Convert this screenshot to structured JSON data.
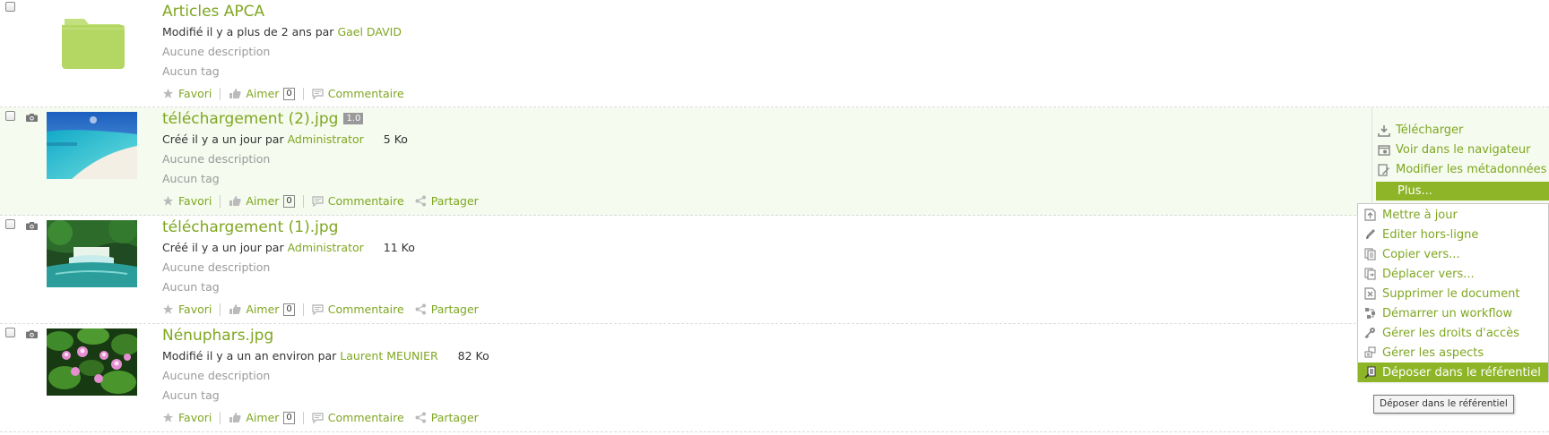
{
  "items": [
    {
      "title": "Articles APCA",
      "version": "",
      "meta_prefix": "Modifié il y a plus de 2 ans par",
      "author": "Gael DAVID",
      "size": "",
      "description": "Aucune description",
      "tags": "Aucun tag",
      "thumbnail": "folder-icon"
    },
    {
      "title": "téléchargement (2).jpg",
      "version": "1.0",
      "meta_prefix": "Créé il y a un jour par",
      "author": "Administrator",
      "size": "5 Ko",
      "description": "Aucune description",
      "tags": "Aucun tag",
      "thumbnail": "beach-image"
    },
    {
      "title": "téléchargement (1).jpg",
      "version": "",
      "meta_prefix": "Créé il y a un jour par",
      "author": "Administrator",
      "size": "11 Ko",
      "description": "Aucune description",
      "tags": "Aucun tag",
      "thumbnail": "waterfall-image"
    },
    {
      "title": "Nénuphars.jpg",
      "version": "",
      "meta_prefix": "Modifié il y a un an environ par",
      "author": "Laurent MEUNIER",
      "size": "82 Ko",
      "description": "Aucune description",
      "tags": "Aucun tag",
      "thumbnail": "water-lilies-image"
    }
  ],
  "actions": {
    "favori": "Favori",
    "aimer": "Aimer",
    "like_count": "0",
    "commentaire": "Commentaire",
    "partager": "Partager"
  },
  "right_menu": {
    "telecharger": "Télécharger",
    "voir": "Voir dans le navigateur",
    "modifier": "Modifier les métadonnées",
    "plus": "Plus..."
  },
  "dropdown": [
    {
      "label": "Mettre à jour",
      "icon": "upload-icon"
    },
    {
      "label": "Editer hors-ligne",
      "icon": "pencil-icon"
    },
    {
      "label": "Copier vers...",
      "icon": "copy-icon"
    },
    {
      "label": "Déplacer vers...",
      "icon": "move-icon"
    },
    {
      "label": "Supprimer le document",
      "icon": "delete-icon"
    },
    {
      "label": "Démarrer un workflow",
      "icon": "workflow-icon"
    },
    {
      "label": "Gérer les droits d'accès",
      "icon": "key-icon"
    },
    {
      "label": "Gérer les aspects",
      "icon": "aspects-icon"
    },
    {
      "label": "Déposer dans le référentiel",
      "icon": "deposit-icon",
      "highlighted": true
    }
  ],
  "tooltip": "Déposer dans le référentiel",
  "colors": {
    "accent": "#7fa722",
    "highlight": "#8db527",
    "selected_row": "#f5fbee",
    "muted_text": "#9a9a9a"
  }
}
